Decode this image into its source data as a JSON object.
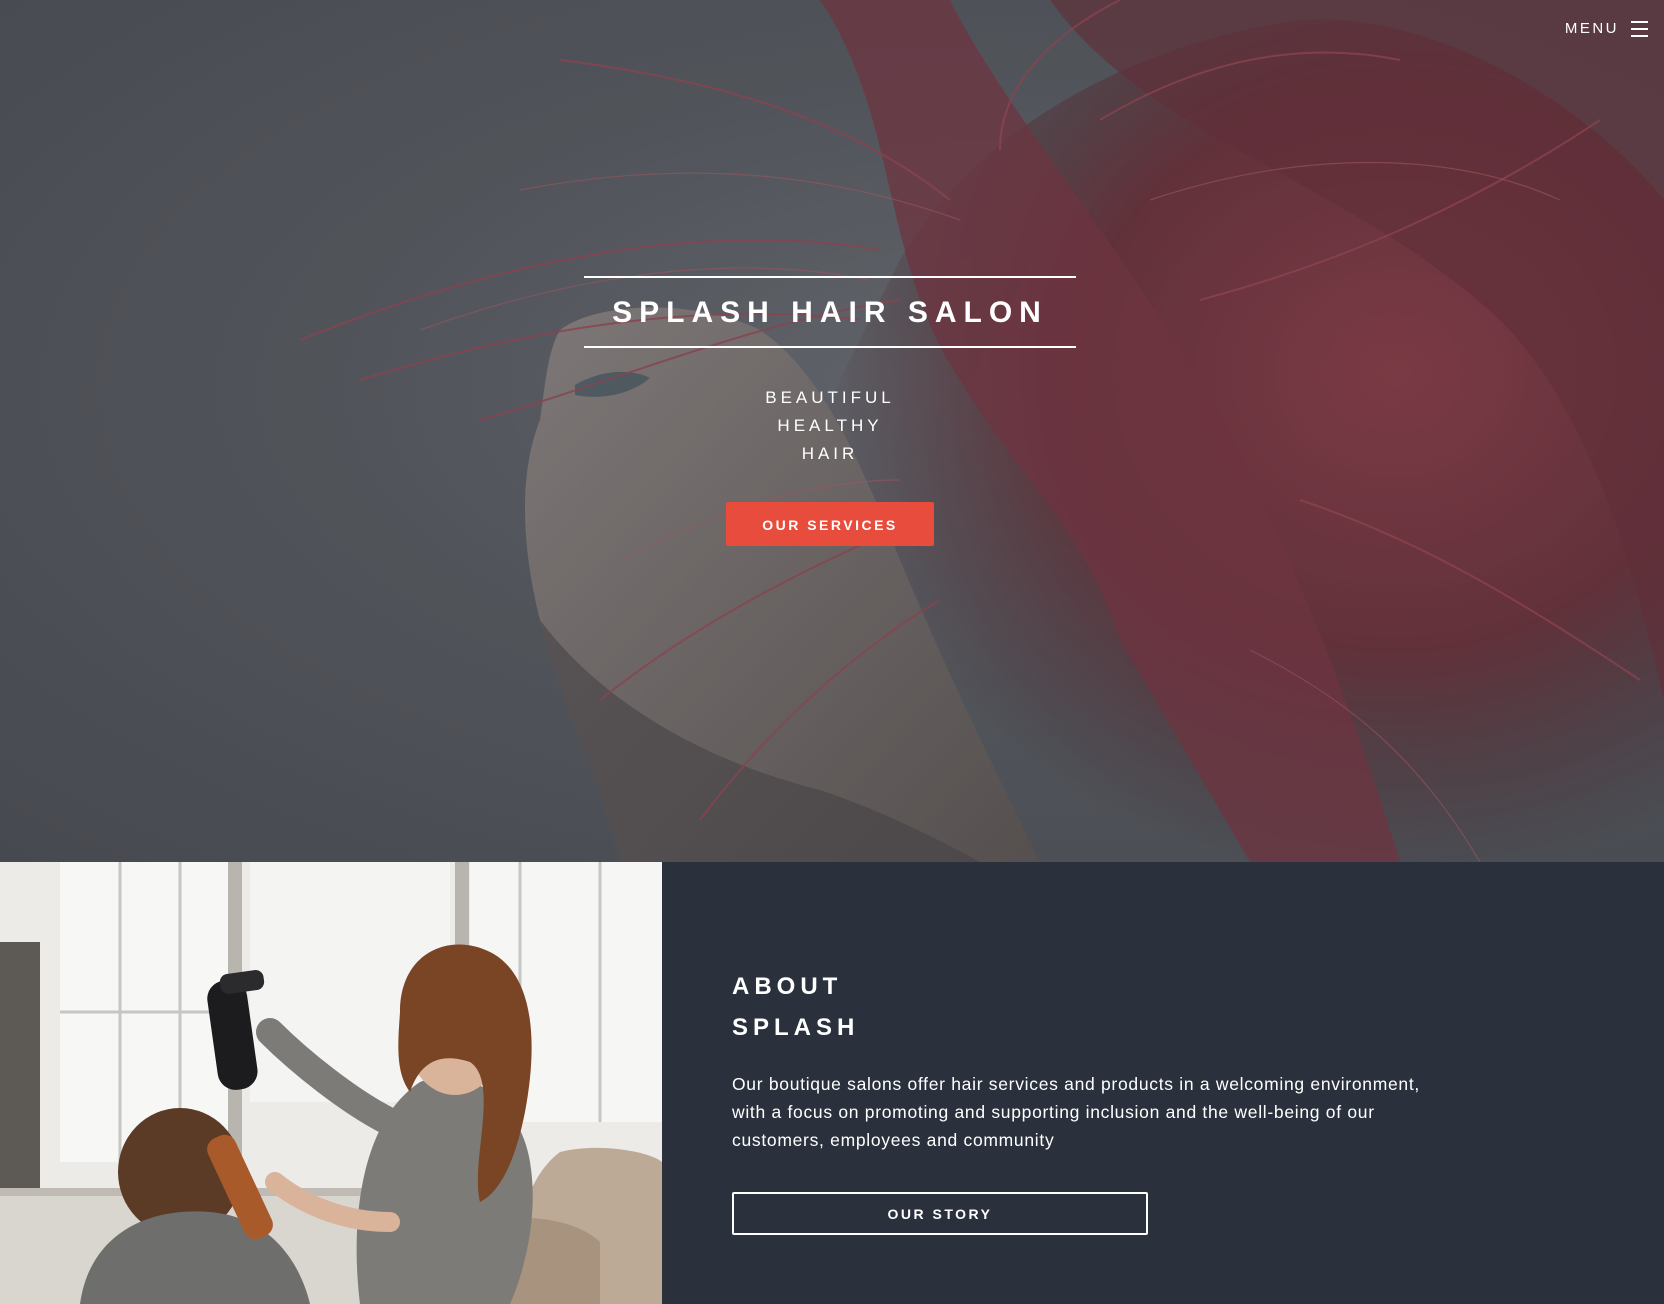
{
  "nav": {
    "menu_label": "MENU",
    "menu_icon": "hamburger-icon"
  },
  "hero": {
    "title": "SPLASH HAIR SALON",
    "tagline": [
      "BEAUTIFUL",
      "HEALTHY",
      "HAIR"
    ],
    "cta_label": "OUR SERVICES",
    "background_image": "woman-with-red-hair-blowing"
  },
  "about": {
    "heading": [
      "ABOUT",
      "SPLASH"
    ],
    "body": "Our boutique salons offer hair services and products in a welcoming environment, with a focus on promoting and supporting inclusion and the well-being of our customers, employees and community",
    "cta_label": "OUR STORY",
    "image": "stylist-blow-drying-client-hair"
  },
  "colors": {
    "accent": "#e74c3c",
    "panel": "#2a313c",
    "text": "#ffffff"
  }
}
